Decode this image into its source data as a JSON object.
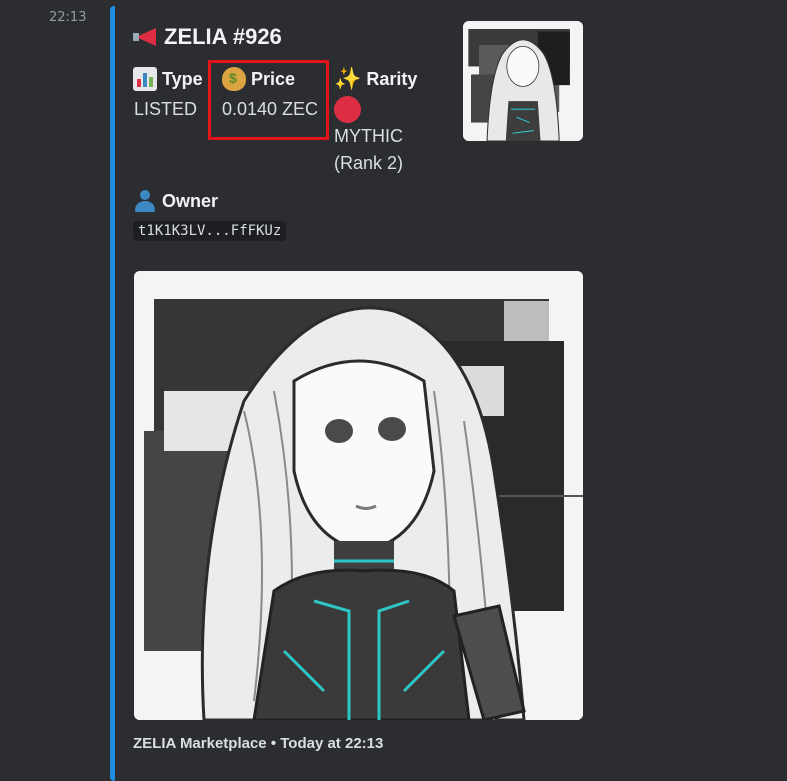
{
  "message": {
    "timestamp": "22:13"
  },
  "embed": {
    "accent_color": "#1f8ce0",
    "title": "ZELIA #926",
    "title_icon": "megaphone-icon",
    "fields": {
      "type": {
        "name": "Type",
        "value": "LISTED",
        "icon": "bar-chart-icon"
      },
      "price": {
        "name": "Price",
        "value": "0.0140 ZEC",
        "icon": "money-bag-icon"
      },
      "rarity": {
        "name": "Rarity",
        "value_line1": "MYTHIC",
        "value_line2": "(Rank 2)",
        "icon": "sparkles-icon",
        "badge_color": "#dd2e44"
      },
      "owner": {
        "name": "Owner",
        "value": "t1K1K3LV...FfFKUz",
        "icon": "person-icon"
      }
    },
    "footer": "ZELIA Marketplace • Today at 22:13"
  },
  "annotation": {
    "highlight_color": "#e5141b",
    "highlighted_field": "price"
  }
}
